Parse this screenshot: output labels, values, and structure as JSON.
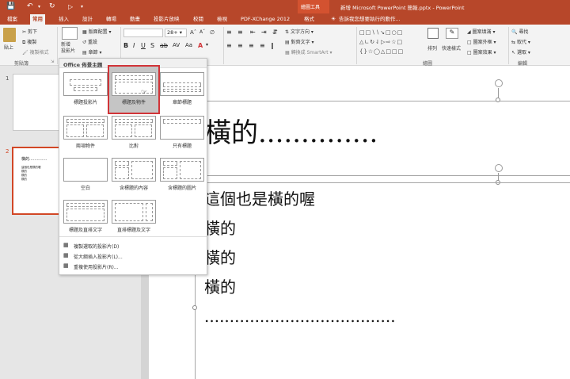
{
  "window": {
    "title": "新增 Microsoft PowerPoint 簡報.pptx - PowerPoint",
    "context_tab_group": "繪圖工具"
  },
  "tabs": [
    "檔案",
    "常用",
    "插入",
    "設計",
    "轉場",
    "動畫",
    "投影片放映",
    "校閱",
    "檢視",
    "PDF-XChange 2012",
    "格式"
  ],
  "tell_me": "告訴我您想要執行的動作...",
  "ribbon": {
    "paste": "貼上",
    "cut": "剪下",
    "copy": "複製",
    "format_painter": "複製格式",
    "clipboard": "剪貼簿",
    "new_slide": "新增\n投影片",
    "layout": "版面配置",
    "reset": "重設",
    "section": "章節",
    "font_size": "28+",
    "text_direction": "文字方向",
    "align_text": "對齊文字",
    "smartart": "轉換成 SmartArt",
    "arrange": "排列",
    "quick_styles": "快速樣式",
    "shape_fill": "圖案填滿",
    "shape_outline": "圖案外框",
    "shape_effects": "圖案效果",
    "find": "尋找",
    "replace": "取代",
    "select": "選取",
    "drawing_group": "繪圖",
    "editing_group": "編輯"
  },
  "thumbs": [
    {
      "num": "1"
    },
    {
      "num": "2",
      "title": "橫的..............",
      "lines": [
        "這個也是橫的喔",
        "橫的",
        "橫的",
        "橫的"
      ]
    }
  ],
  "menu": {
    "header": "Office 佈景主題",
    "layouts": [
      "標題投影片",
      "標題及物件",
      "章節標題",
      "兩項物件",
      "比對",
      "只有標題",
      "空白",
      "含標題的內容",
      "含標題的圖片",
      "標題及直排文字",
      "直排標題及文字"
    ],
    "items": [
      "複製選取的投影片(D)",
      "從大綱插入投影片(L)...",
      "重複使用投影片(R)..."
    ]
  },
  "slide": {
    "title": "橫的..............",
    "body": [
      "這個也是橫的喔",
      "橫的",
      "橫的",
      "橫的",
      "......................................"
    ]
  },
  "colors": {
    "accent": "#b7472a",
    "highlight": "#d13438"
  }
}
